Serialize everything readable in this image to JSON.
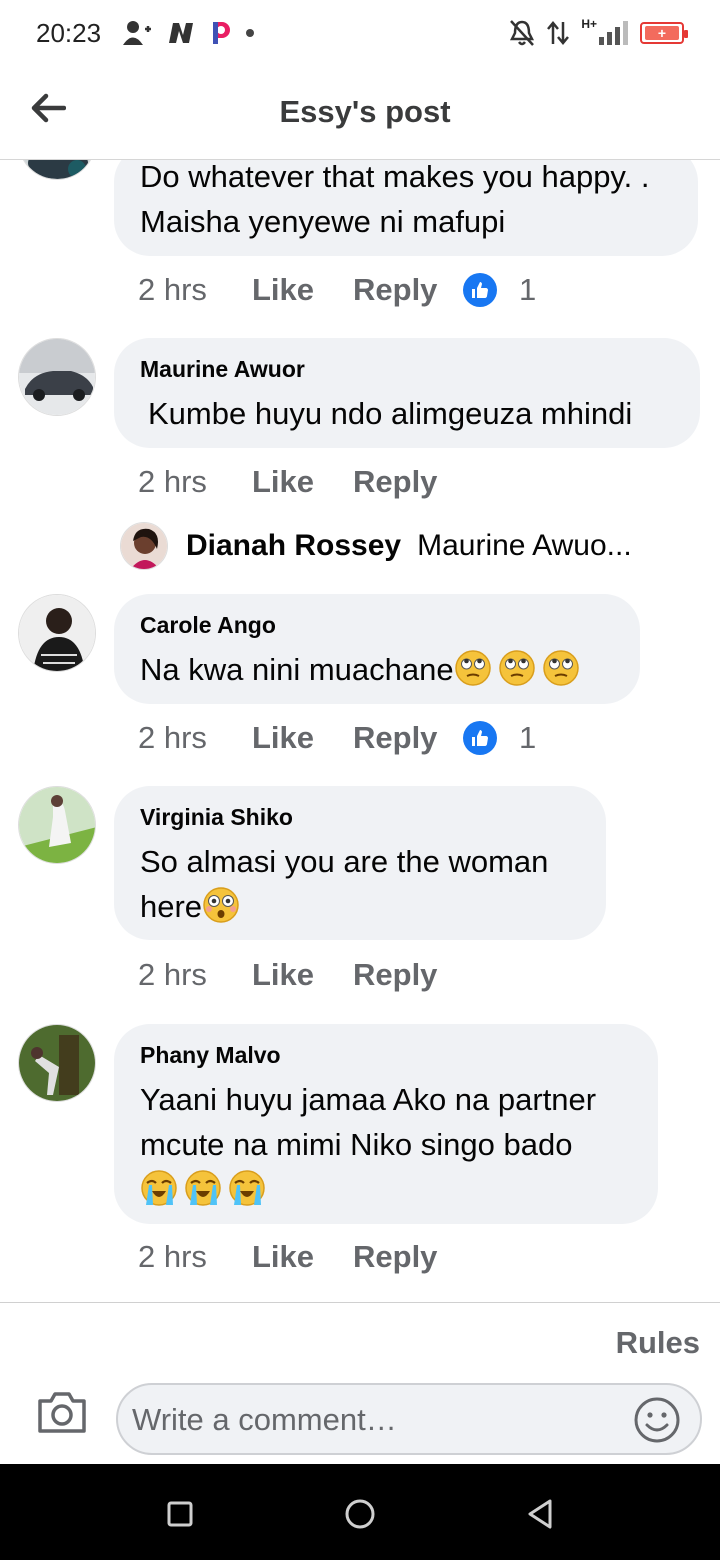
{
  "status_bar": {
    "time": "20:23",
    "network": "H+",
    "battery_color": "#e53935"
  },
  "header": {
    "title": "Essy's post",
    "back_icon": "arrow-left-icon"
  },
  "comments": [
    {
      "author": "",
      "text": "Do whatever that makes you happy. . Maisha yenyewe ni mafupi",
      "time": "2 hrs",
      "like_label": "Like",
      "reply_label": "Reply",
      "reaction_count": "1"
    },
    {
      "author": "Maurine Awuor",
      "text": "Kumbe huyu ndo alimgeuza mhindi",
      "time": "2 hrs",
      "like_label": "Like",
      "reply_label": "Reply"
    },
    {
      "author": "Carole Ango",
      "text": "Na kwa nini muachane",
      "emoji": [
        "face-with-rolling-eyes",
        "face-with-rolling-eyes",
        "face-with-rolling-eyes"
      ],
      "time": "2 hrs",
      "like_label": "Like",
      "reply_label": "Reply",
      "reaction_count": "1"
    },
    {
      "author": "Virginia Shiko",
      "text": "So almasi you are the woman here",
      "emoji": [
        "flushed-face"
      ],
      "time": "2 hrs",
      "like_label": "Like",
      "reply_label": "Reply"
    },
    {
      "author": "Phany Malvo",
      "text": "Yaani huyu jamaa Ako na partner mcute na mimi Niko singo bado",
      "emoji": [
        "loudly-crying-face",
        "loudly-crying-face",
        "loudly-crying-face"
      ],
      "time": "2 hrs",
      "like_label": "Like",
      "reply_label": "Reply"
    }
  ],
  "reply_preview": {
    "author": "Dianah Rossey",
    "text": "Maurine Awuo..."
  },
  "footer": {
    "rules_label": "Rules",
    "comment_placeholder": "Write a comment…"
  },
  "colors": {
    "bubble_bg": "#f0f2f5",
    "meta_text": "#65676b",
    "like_blue": "#1877f2"
  }
}
